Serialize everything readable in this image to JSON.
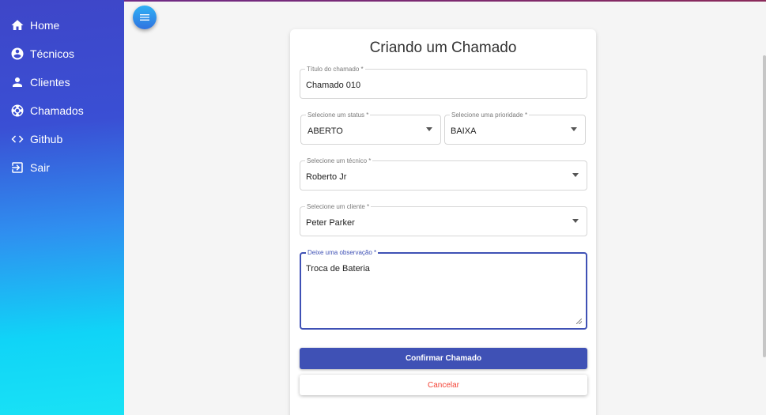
{
  "sidebar": {
    "items": [
      {
        "label": "Home",
        "icon": "home-icon"
      },
      {
        "label": "Técnicos",
        "icon": "account-circle-icon"
      },
      {
        "label": "Clientes",
        "icon": "person-icon"
      },
      {
        "label": "Chamados",
        "icon": "support-icon"
      },
      {
        "label": "Github",
        "icon": "code-icon"
      },
      {
        "label": "Sair",
        "icon": "logout-icon"
      }
    ]
  },
  "form": {
    "title": "Criando um Chamado",
    "titulo": {
      "label": "Título do chamado *",
      "value": "Chamado 010"
    },
    "status": {
      "label": "Selecione um status *",
      "value": "ABERTO"
    },
    "prioridade": {
      "label": "Selecione uma prioridade *",
      "value": "BAIXA"
    },
    "tecnico": {
      "label": "Selecione um técnico *",
      "value": "Roberto Jr"
    },
    "cliente": {
      "label": "Selecione um cliente *",
      "value": "Peter Parker"
    },
    "observacao": {
      "label": "Deixe uma observação *",
      "value": "Troca de Bateria"
    },
    "confirm_label": "Confirmar Chamado",
    "cancel_label": "Cancelar"
  },
  "colors": {
    "primary": "#3f51b5",
    "warn": "#f44336"
  }
}
